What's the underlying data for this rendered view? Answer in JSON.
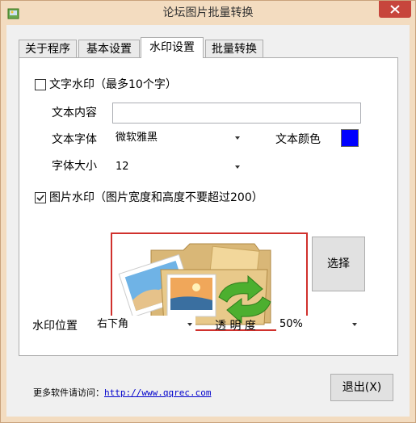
{
  "window": {
    "title": "论坛图片批量转换",
    "accent_color": "#c7463c",
    "frame_color": "#f3dcc0"
  },
  "tabs": [
    {
      "label": "关于程序",
      "active": false
    },
    {
      "label": "基本设置",
      "active": false
    },
    {
      "label": "水印设置",
      "active": true
    },
    {
      "label": "批量转换",
      "active": false
    }
  ],
  "text_watermark": {
    "checkbox_label": "文字水印（最多10个字）",
    "checked": false,
    "content_label": "文本内容",
    "content_value": "",
    "font_label": "文本字体",
    "font_value": "微软雅黑",
    "color_label": "文本颜色",
    "color_value": "#0000ff",
    "size_label": "字体大小",
    "size_value": "12"
  },
  "image_watermark": {
    "checkbox_label": "图片水印（图片宽度和高度不要超过200）",
    "checked": true,
    "preview_icon": "photo-folder-sync-icon",
    "select_button": "选择"
  },
  "position": {
    "label": "水印位置",
    "value": "右下角"
  },
  "opacity": {
    "label": "透 明 度",
    "value": "50%"
  },
  "footer": {
    "text": "更多软件请访问：",
    "link": "http://www.qqrec.com"
  },
  "exit_button": "退出(X)"
}
